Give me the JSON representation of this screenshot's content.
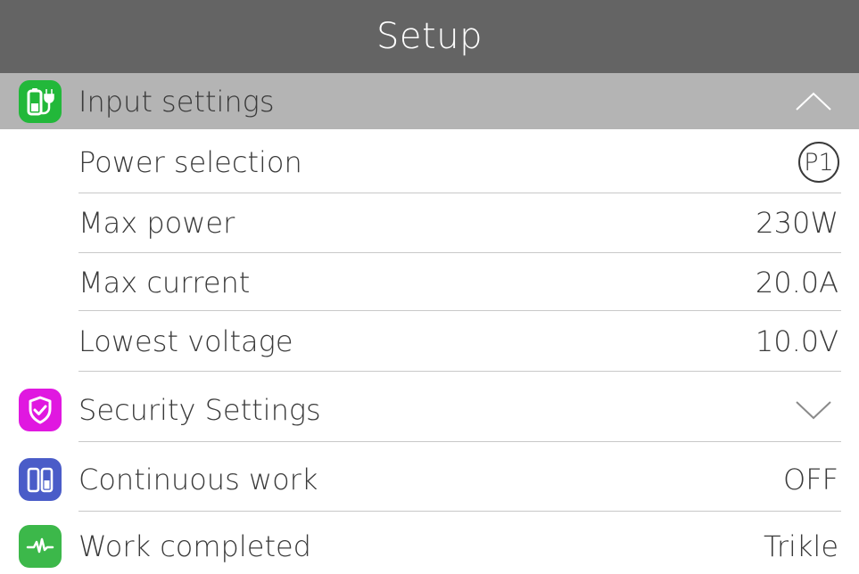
{
  "header": {
    "title": "Setup"
  },
  "colors": {
    "title_bar": "#646464",
    "expanded_header": "#b4b4b4",
    "input_icon": "#22b83a",
    "security_icon": "#e018e0",
    "continuous_icon": "#4a5cc8",
    "completed_icon": "#3cb84a"
  },
  "sections": {
    "input": {
      "label": "Input settings",
      "icon": "battery-plug-icon",
      "state": "expanded",
      "items": [
        {
          "label": "Power selection",
          "value": "P1"
        },
        {
          "label": "Max power",
          "value": "230W"
        },
        {
          "label": "Max current",
          "value": "20.0A"
        },
        {
          "label": "Lowest voltage",
          "value": "10.0V"
        }
      ]
    },
    "security": {
      "label": "Security Settings",
      "icon": "shield-check-icon",
      "state": "collapsed"
    },
    "continuous": {
      "label": "Continuous work",
      "icon": "dual-battery-icon",
      "value": "OFF"
    },
    "completed": {
      "label": "Work completed",
      "icon": "pulse-icon",
      "value": "Trikle"
    }
  }
}
